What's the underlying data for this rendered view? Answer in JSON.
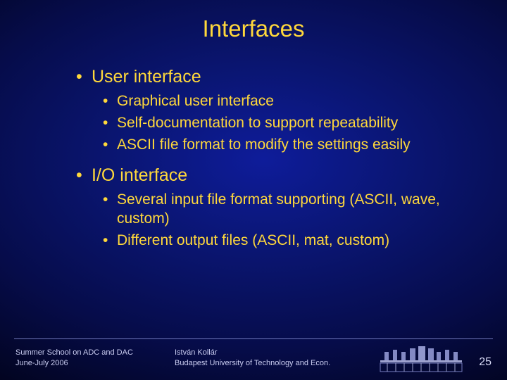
{
  "title": "Interfaces",
  "bullets": {
    "b1": "User interface",
    "b1_subs": {
      "s1": "Graphical user interface",
      "s2": "Self-documentation to support repeatability",
      "s3": "ASCII file format to modify the settings easily"
    },
    "b2": "I/O interface",
    "b2_subs": {
      "s1": "Several input file format supporting (ASCII, wave, custom)",
      "s2": "Different output files (ASCII, mat, custom)"
    }
  },
  "footer": {
    "left_line1": "Summer School on ADC and DAC",
    "left_line2": "June-July 2006",
    "mid_line1": "István Kollár",
    "mid_line2": "Budapest University of Technology and Econ.",
    "page": "25"
  },
  "colors": {
    "text": "#ffd83b",
    "bg_center": "#0e1c9a",
    "bg_edge": "#000008"
  }
}
